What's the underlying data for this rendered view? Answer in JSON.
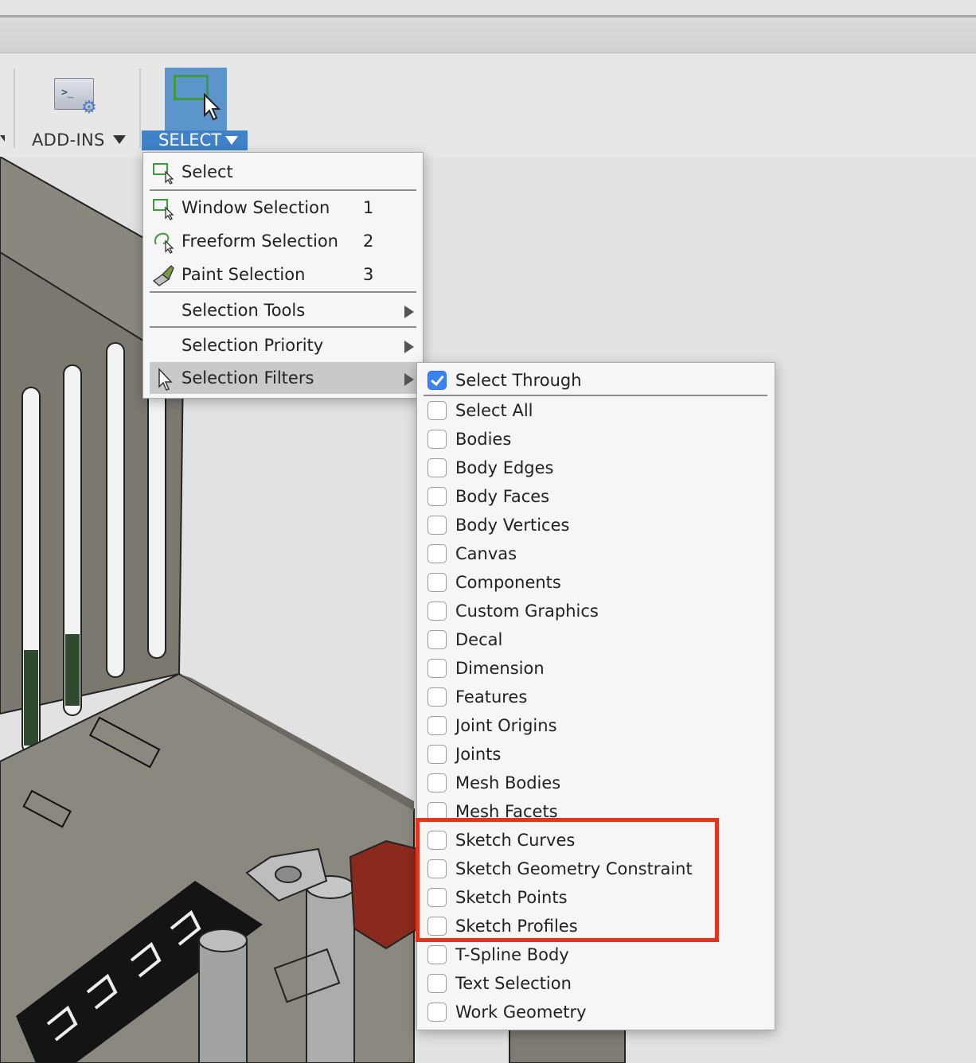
{
  "toolbar": {
    "addins_label": "ADD-INS",
    "addins_icon": "script-gear-icon",
    "select_label": "SELECT",
    "select_icon": "window-select-cursor-icon"
  },
  "select_menu": {
    "items": [
      {
        "label": "Select",
        "icon": "select-rect-icon"
      },
      {
        "label": "Window Selection",
        "key": "1",
        "icon": "window-select-icon"
      },
      {
        "label": "Freeform Selection",
        "key": "2",
        "icon": "lasso-icon"
      },
      {
        "label": "Paint Selection",
        "key": "3",
        "icon": "paint-brush-icon"
      },
      {
        "label": "Selection Tools",
        "submenu": true
      },
      {
        "label": "Selection Priority",
        "submenu": true
      },
      {
        "label": "Selection Filters",
        "submenu": true,
        "active": true,
        "icon": "cursor-icon"
      }
    ]
  },
  "filters_menu": {
    "items": [
      {
        "label": "Select Through",
        "checked": true
      },
      {
        "label": "Select All",
        "checked": false
      },
      {
        "label": "Bodies",
        "checked": false
      },
      {
        "label": "Body Edges",
        "checked": false
      },
      {
        "label": "Body Faces",
        "checked": false
      },
      {
        "label": "Body Vertices",
        "checked": false
      },
      {
        "label": "Canvas",
        "checked": false
      },
      {
        "label": "Components",
        "checked": false
      },
      {
        "label": "Custom Graphics",
        "checked": false
      },
      {
        "label": "Decal",
        "checked": false
      },
      {
        "label": "Dimension",
        "checked": false
      },
      {
        "label": "Features",
        "checked": false
      },
      {
        "label": "Joint Origins",
        "checked": false
      },
      {
        "label": "Joints",
        "checked": false
      },
      {
        "label": "Mesh Bodies",
        "checked": false
      },
      {
        "label": "Mesh Facets",
        "checked": false
      },
      {
        "label": "Sketch Curves",
        "checked": false
      },
      {
        "label": "Sketch Geometry Constraint",
        "checked": false
      },
      {
        "label": "Sketch Points",
        "checked": false
      },
      {
        "label": "Sketch Profiles",
        "checked": false
      },
      {
        "label": "T-Spline Body",
        "checked": false
      },
      {
        "label": "Text Selection",
        "checked": false
      },
      {
        "label": "Work Geometry",
        "checked": false
      }
    ]
  },
  "colors": {
    "select_blue": "#3f82c8",
    "checkbox_blue": "#3b82f0",
    "annotation_red": "#e5341d",
    "model_body": "#7d7a72"
  }
}
